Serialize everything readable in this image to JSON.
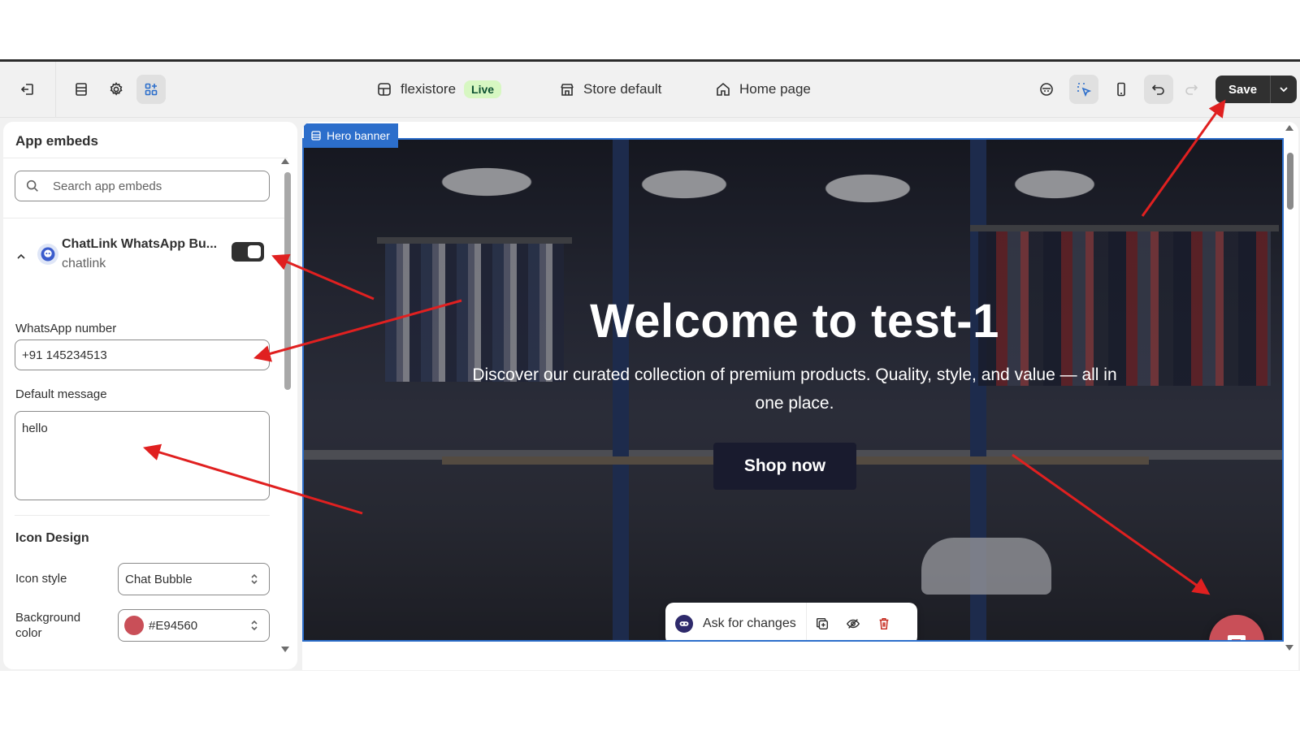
{
  "topbar": {
    "store_name": "flexistore",
    "store_status": "Live",
    "theme_label": "Store default",
    "page_label": "Home page",
    "save_label": "Save"
  },
  "sidebar": {
    "title": "App embeds",
    "search_placeholder": "Search app embeds",
    "app": {
      "name": "ChatLink WhatsApp Bu...",
      "handle": "chatlink",
      "enabled": true
    },
    "whatsapp_label": "WhatsApp number",
    "whatsapp_value": "+91 145234513",
    "message_label": "Default message",
    "message_value": "hello",
    "icon_design_title": "Icon Design",
    "icon_style_label": "Icon style",
    "icon_style_value": "Chat Bubble",
    "bg_color_label": "Background color",
    "bg_color_value": "#E94560"
  },
  "preview": {
    "section_tag": "Hero banner",
    "hero_title": "Welcome to test-1",
    "hero_subtitle": "Discover our curated collection of premium products. Quality, style, and value — all in one place.",
    "cta_label": "Shop now",
    "ask_label": "Ask for changes"
  },
  "colors": {
    "accent_blue": "#2c6ecb",
    "chat_icon_bg": "#c94f58",
    "annotation_arrow": "#e02020"
  }
}
